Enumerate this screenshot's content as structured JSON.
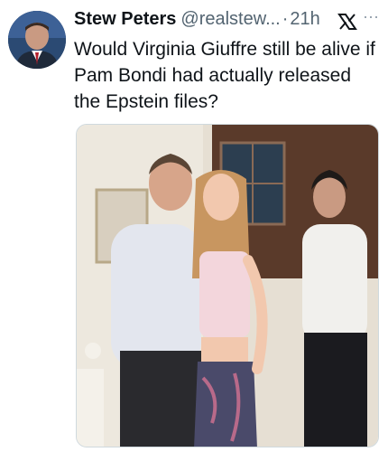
{
  "tweet": {
    "display_name": "Stew Peters",
    "handle": "@realstew...",
    "separator": "·",
    "time": "21h",
    "more": "···",
    "text": "Would Virginia Giuffre still be alive if Pam Bondi had actually released the Epstein files?"
  },
  "icons": {
    "avatar": "profile-avatar",
    "x": "x-logo-icon",
    "more": "more-options-icon"
  },
  "colors": {
    "text_primary": "#0f1419",
    "text_secondary": "#536471",
    "border": "#cfd9de"
  }
}
